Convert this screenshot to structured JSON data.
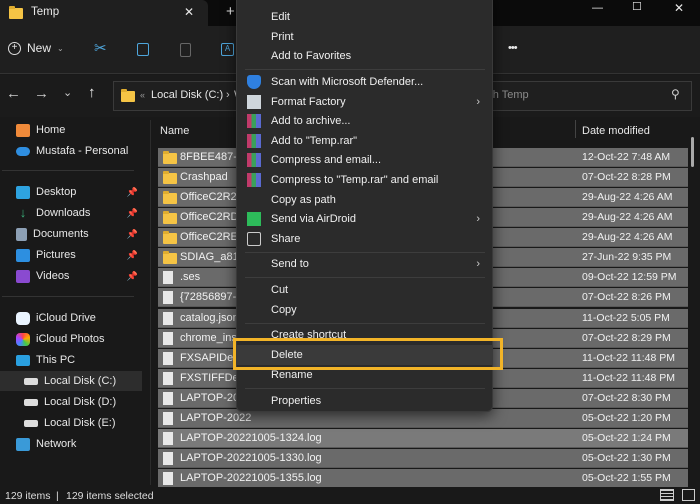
{
  "window": {
    "tab_title": "Temp",
    "close_tab": "✕",
    "new_tab": "+",
    "minimize": "—",
    "maximize": "☐",
    "close": "✕"
  },
  "toolbar": {
    "new_label": "New",
    "more": "•••"
  },
  "address": {
    "path_prefix": "«",
    "crumb1": "Local Disk (C:)",
    "crumb_sep": "›",
    "crumb2": "W",
    "search_placeholder": "Search Temp"
  },
  "sidebar": {
    "top": [
      {
        "label": "Home"
      },
      {
        "label": "Mustafa - Personal"
      }
    ],
    "quick": [
      {
        "label": "Desktop"
      },
      {
        "label": "Downloads"
      },
      {
        "label": "Documents"
      },
      {
        "label": "Pictures"
      },
      {
        "label": "Videos"
      }
    ],
    "places": [
      {
        "label": "iCloud Drive"
      },
      {
        "label": "iCloud Photos"
      },
      {
        "label": "This PC"
      },
      {
        "label": "Local Disk (C:)"
      },
      {
        "label": "Local Disk (D:)"
      },
      {
        "label": "Local Disk (E:)"
      },
      {
        "label": "Network"
      }
    ]
  },
  "columns": {
    "name": "Name",
    "date": "Date modified"
  },
  "files": [
    {
      "name": "8FBEE487-05",
      "date": "12-Oct-22 7:48 AM",
      "type": "folder"
    },
    {
      "name": "Crashpad",
      "date": "07-Oct-22 8:28 PM",
      "type": "folder"
    },
    {
      "name": "OfficeC2R2D",
      "date": "29-Aug-22 4:26 AM",
      "type": "folder"
    },
    {
      "name": "OfficeC2RD8",
      "date": "29-Aug-22 4:26 AM",
      "type": "folder"
    },
    {
      "name": "OfficeC2REBI",
      "date": "29-Aug-22 4:26 AM",
      "type": "folder"
    },
    {
      "name": "SDIAG_a8107",
      "date": "27-Jun-22 9:35 PM",
      "type": "folder"
    },
    {
      "name": ".ses",
      "date": "09-Oct-22 12:59 PM",
      "type": "file"
    },
    {
      "name": "{72856897-A",
      "date": "07-Oct-22 8:26 PM",
      "type": "file"
    },
    {
      "name": "catalog.json",
      "date": "11-Oct-22 5:05 PM",
      "type": "file"
    },
    {
      "name": "chrome_insta",
      "date": "07-Oct-22 8:29 PM",
      "type": "file"
    },
    {
      "name": "FXSAPIDebu",
      "date": "11-Oct-22 11:48 PM",
      "type": "file"
    },
    {
      "name": "FXSTIFFDeb",
      "date": "11-Oct-22 11:48 PM",
      "type": "file"
    },
    {
      "name": "LAPTOP-2022",
      "date": "07-Oct-22 8:30 PM",
      "type": "file"
    },
    {
      "name": "LAPTOP-2022",
      "date": "05-Oct-22 1:20 PM",
      "type": "file"
    },
    {
      "name": "LAPTOP-20221005-1324.log",
      "date": "05-Oct-22 1:24 PM",
      "type": "file"
    },
    {
      "name": "LAPTOP-20221005-1330.log",
      "date": "05-Oct-22 1:30 PM",
      "type": "file"
    },
    {
      "name": "LAPTOP-20221005-1355.log",
      "date": "05-Oct-22 1:55 PM",
      "type": "file"
    }
  ],
  "menu": [
    {
      "label": "Edit"
    },
    {
      "label": "Print"
    },
    {
      "label": "Add to Favorites"
    },
    {
      "label": "Scan with Microsoft Defender..."
    },
    {
      "label": "Format Factory",
      "sub": "›"
    },
    {
      "label": "Add to archive..."
    },
    {
      "label": "Add to \"Temp.rar\""
    },
    {
      "label": "Compress and email..."
    },
    {
      "label": "Compress to \"Temp.rar\" and email"
    },
    {
      "label": "Copy as path"
    },
    {
      "label": "Send via AirDroid",
      "sub": "›"
    },
    {
      "label": "Share"
    },
    {
      "label": "Send to",
      "sub": "›"
    },
    {
      "label": "Cut"
    },
    {
      "label": "Copy"
    },
    {
      "label": "Create shortcut"
    },
    {
      "label": "Delete"
    },
    {
      "label": "Rename"
    },
    {
      "label": "Properties"
    }
  ],
  "status": {
    "count": "129 items",
    "sep": "|",
    "selected": "129 items selected"
  },
  "colors": {
    "highlight": "#f2b428",
    "selection": "#6a6a6a"
  }
}
